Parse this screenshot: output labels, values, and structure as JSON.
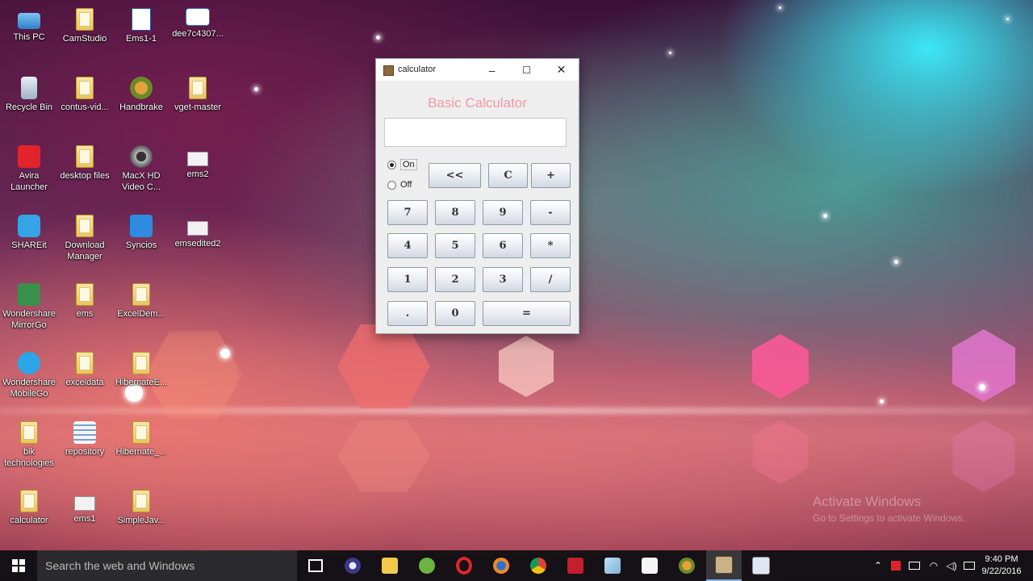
{
  "desktop": {
    "icons": [
      {
        "label": "This PC",
        "icon": "computer-icon"
      },
      {
        "label": "CamStudio",
        "icon": "folder-icon"
      },
      {
        "label": "Ems1-1",
        "icon": "document-icon"
      },
      {
        "label": "dee7c4307...",
        "icon": "image-file-icon"
      },
      {
        "label": "Recycle Bin",
        "icon": "recycle-bin-icon"
      },
      {
        "label": "contus-vid...",
        "icon": "folder-icon"
      },
      {
        "label": "Handbrake",
        "icon": "handbrake-icon"
      },
      {
        "label": "vget-master",
        "icon": "folder-icon"
      },
      {
        "label": "Avira\nLauncher",
        "icon": "avira-icon"
      },
      {
        "label": "desktop files",
        "icon": "folder-icon"
      },
      {
        "label": "MacX HD\nVideo C...",
        "icon": "film-reel-icon"
      },
      {
        "label": "ems2",
        "icon": "shortcut-icon"
      },
      {
        "label": "SHAREit",
        "icon": "shareit-icon"
      },
      {
        "label": "Download\nManager",
        "icon": "folder-icon"
      },
      {
        "label": "Syncios",
        "icon": "syncios-icon"
      },
      {
        "label": "emsedited2",
        "icon": "shortcut-icon"
      },
      {
        "label": "Wondershare\nMirrorGo",
        "icon": "mirrorgo-icon"
      },
      {
        "label": "ems",
        "icon": "folder-icon"
      },
      {
        "label": "ExcelDem...",
        "icon": "folder-icon"
      },
      {
        "label": "Wondershare\nMobileGo",
        "icon": "mobilego-icon"
      },
      {
        "label": "exceldata",
        "icon": "folder-icon"
      },
      {
        "label": "HibernateE...",
        "icon": "folder-icon"
      },
      {
        "label": "bik\ntechnologies",
        "icon": "folder-icon"
      },
      {
        "label": "repository",
        "icon": "repository-icon"
      },
      {
        "label": "Hibernate_...",
        "icon": "folder-icon"
      },
      {
        "label": "calculator",
        "icon": "folder-icon"
      },
      {
        "label": "ems1",
        "icon": "shortcut-icon"
      },
      {
        "label": "SimpleJav...",
        "icon": "folder-icon"
      }
    ]
  },
  "window": {
    "title": "calculator",
    "minimize_glyph": "–",
    "maximize_glyph": "☐",
    "close_glyph": "✕",
    "heading": "Basic Calculator",
    "display_value": "",
    "power": {
      "on_label": "On",
      "off_label": "Off",
      "selected": "On"
    },
    "buttons": {
      "backspace": "<<",
      "clear": "C",
      "plus": "+",
      "seven": "7",
      "eight": "8",
      "nine": "9",
      "minus": "-",
      "four": "4",
      "five": "5",
      "six": "6",
      "multiply": "*",
      "one": "1",
      "two": "2",
      "three": "3",
      "divide": "/",
      "dot": ".",
      "zero": "0",
      "equals": "="
    }
  },
  "watermark": {
    "line1": "Activate Windows",
    "line2": "Go to Settings to activate Windows."
  },
  "taskbar": {
    "search_placeholder": "Search the web and Windows",
    "apps": [
      "task-view-icon",
      "eclipse-icon",
      "file-explorer-icon",
      "spring-icon",
      "opera-icon",
      "firefox-icon",
      "chrome-icon",
      "filezilla-icon",
      "notepad-icon",
      "java-icon",
      "handbrake-icon",
      "calculator-app-icon",
      "camstudio-icon"
    ],
    "active_app": "calculator-app-icon",
    "clock_time": "9:40 PM",
    "clock_date": "9/22/2016",
    "accent_color": "#7fb0e6"
  },
  "colors": {
    "heading": "#f29aa8",
    "taskbar": "#101014"
  }
}
